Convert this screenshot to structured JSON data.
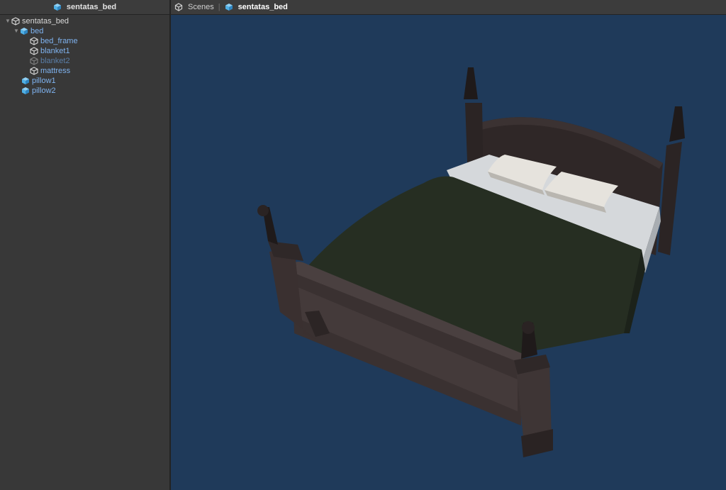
{
  "hierarchy": {
    "title": "sentatas_bed",
    "items": [
      {
        "label": "sentatas_bed"
      },
      {
        "label": "bed"
      },
      {
        "label": "bed_frame"
      },
      {
        "label": "blanket1"
      },
      {
        "label": "blanket2"
      },
      {
        "label": "mattress"
      },
      {
        "label": "pillow1"
      },
      {
        "label": "pillow2"
      }
    ]
  },
  "scene": {
    "breadcrumb": {
      "root": "Scenes",
      "separator": "|",
      "current": "sentatas_bed"
    }
  },
  "colors": {
    "viewport_bg": "#1f3a5a",
    "panel_bg": "#383838",
    "prefab_text": "#7fb3f0",
    "prefab_icon": "#4fb0e6"
  },
  "icons": {
    "hierarchy_header": "prefab-cube-icon",
    "scenes": "unity-logo-icon",
    "root_object": "gameobject-cube-icon",
    "child_object": "gameobject-cube-icon",
    "prefab": "prefab-cube-icon"
  }
}
